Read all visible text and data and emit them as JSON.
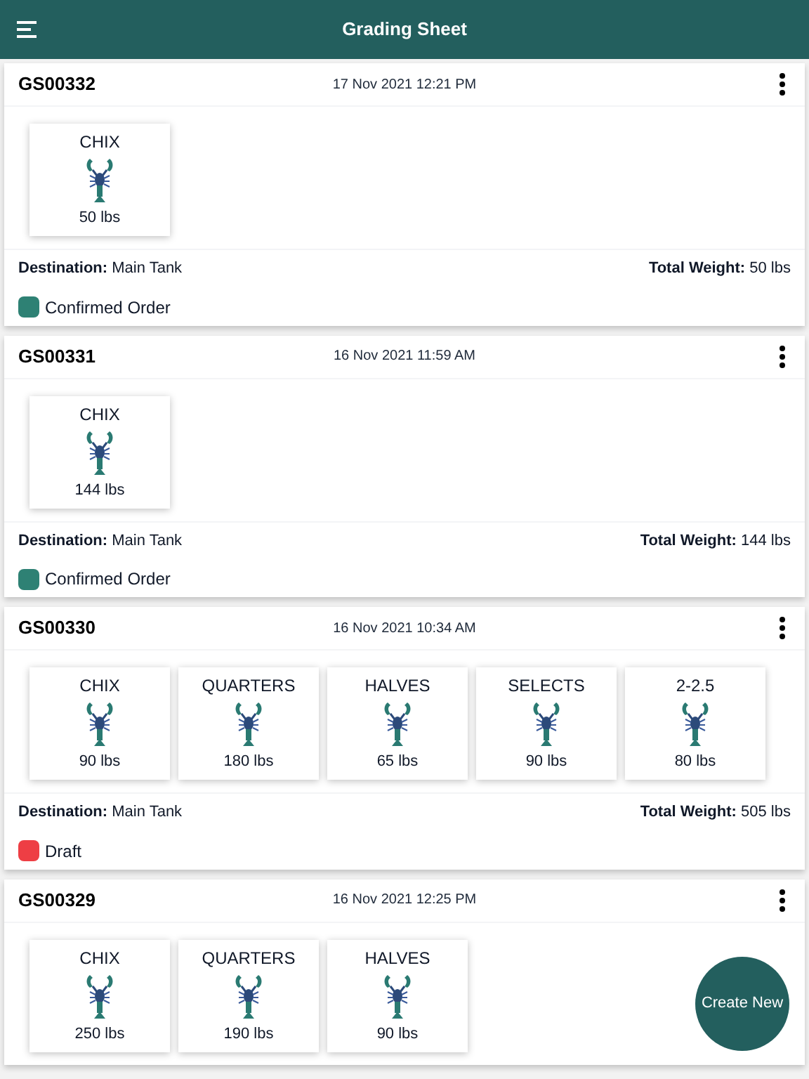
{
  "header": {
    "title": "Grading Sheet"
  },
  "sheets": [
    {
      "id": "GS00332",
      "date": "17 Nov 2021 12:21 PM",
      "grades": [
        {
          "name": "CHIX",
          "weight": "50 lbs"
        }
      ],
      "destination_label": "Destination:",
      "destination": "Main Tank",
      "total_label": "Total Weight:",
      "total": "50 lbs",
      "status": {
        "label": "Confirmed Order",
        "color": "#2e8174"
      }
    },
    {
      "id": "GS00331",
      "date": "16 Nov 2021 11:59 AM",
      "grades": [
        {
          "name": "CHIX",
          "weight": "144 lbs"
        }
      ],
      "destination_label": "Destination:",
      "destination": "Main Tank",
      "total_label": "Total Weight:",
      "total": "144 lbs",
      "status": {
        "label": "Confirmed Order",
        "color": "#2e8174"
      }
    },
    {
      "id": "GS00330",
      "date": "16 Nov 2021 10:34 AM",
      "grades": [
        {
          "name": "CHIX",
          "weight": "90 lbs"
        },
        {
          "name": "QUARTERS",
          "weight": "180 lbs"
        },
        {
          "name": "HALVES",
          "weight": "65 lbs"
        },
        {
          "name": "SELECTS",
          "weight": "90 lbs"
        },
        {
          "name": "2-2.5",
          "weight": "80 lbs"
        }
      ],
      "destination_label": "Destination:",
      "destination": "Main Tank",
      "total_label": "Total Weight:",
      "total": "505 lbs",
      "status": {
        "label": "Draft",
        "color": "#ee3e44"
      }
    },
    {
      "id": "GS00329",
      "date": "16 Nov 2021 12:25 PM",
      "grades": [
        {
          "name": "CHIX",
          "weight": "250 lbs"
        },
        {
          "name": "QUARTERS",
          "weight": "190 lbs"
        },
        {
          "name": "HALVES",
          "weight": "90 lbs"
        }
      ]
    }
  ],
  "fab": {
    "label": "Create New"
  }
}
